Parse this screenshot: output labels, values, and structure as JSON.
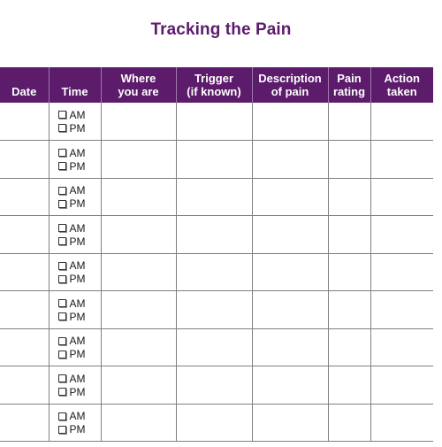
{
  "document": {
    "title": "Tracking the Pain",
    "accent_color": "#5C1B6B",
    "grid_color": "#808080",
    "header_divider_color": "#9F7AAB"
  },
  "table": {
    "columns": [
      {
        "key": "date",
        "label": "Date",
        "label_line1": "Date",
        "label_line2": ""
      },
      {
        "key": "time",
        "label": "Time",
        "label_line1": "Time",
        "label_line2": ""
      },
      {
        "key": "where",
        "label": "Where you are",
        "label_line1": "Where",
        "label_line2": "you are"
      },
      {
        "key": "trigger",
        "label": "Trigger (if known)",
        "label_line1": "Trigger",
        "label_line2": "(if known)"
      },
      {
        "key": "description",
        "label": "Description of pain",
        "label_line1": "Description",
        "label_line2": "of pain"
      },
      {
        "key": "rating",
        "label": "Pain rating",
        "label_line1": "Pain",
        "label_line2": "rating"
      },
      {
        "key": "action",
        "label": "Action taken",
        "label_line1": "Action",
        "label_line2": "taken"
      }
    ],
    "time_options": [
      {
        "label": "AM",
        "checked": false
      },
      {
        "label": "PM",
        "checked": false
      }
    ],
    "row_count": 9,
    "rows": [
      {
        "date": "",
        "time_am": "AM",
        "time_pm": "PM",
        "where": "",
        "trigger": "",
        "description": "",
        "rating": "",
        "action": ""
      },
      {
        "date": "",
        "time_am": "AM",
        "time_pm": "PM",
        "where": "",
        "trigger": "",
        "description": "",
        "rating": "",
        "action": ""
      },
      {
        "date": "",
        "time_am": "AM",
        "time_pm": "PM",
        "where": "",
        "trigger": "",
        "description": "",
        "rating": "",
        "action": ""
      },
      {
        "date": "",
        "time_am": "AM",
        "time_pm": "PM",
        "where": "",
        "trigger": "",
        "description": "",
        "rating": "",
        "action": ""
      },
      {
        "date": "",
        "time_am": "AM",
        "time_pm": "PM",
        "where": "",
        "trigger": "",
        "description": "",
        "rating": "",
        "action": ""
      },
      {
        "date": "",
        "time_am": "AM",
        "time_pm": "PM",
        "where": "",
        "trigger": "",
        "description": "",
        "rating": "",
        "action": ""
      },
      {
        "date": "",
        "time_am": "AM",
        "time_pm": "PM",
        "where": "",
        "trigger": "",
        "description": "",
        "rating": "",
        "action": ""
      },
      {
        "date": "",
        "time_am": "AM",
        "time_pm": "PM",
        "where": "",
        "trigger": "",
        "description": "",
        "rating": "",
        "action": ""
      },
      {
        "date": "",
        "time_am": "AM",
        "time_pm": "PM",
        "where": "",
        "trigger": "",
        "description": "",
        "rating": "",
        "action": ""
      }
    ]
  }
}
